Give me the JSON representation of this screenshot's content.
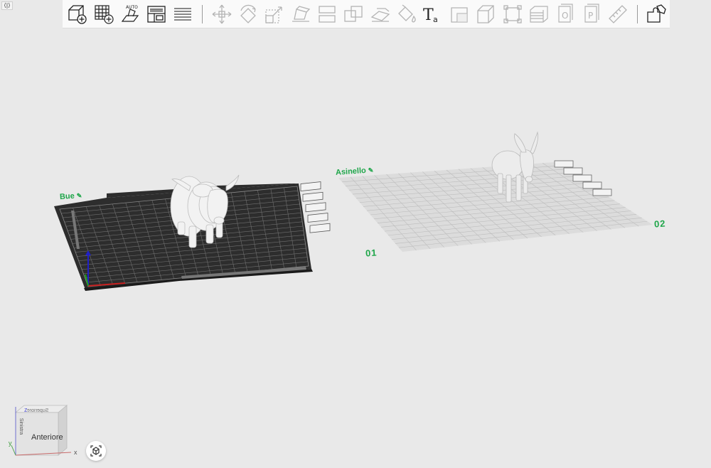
{
  "panel_toggle": "⟨|⟩",
  "toolbar": {
    "buttons": [
      {
        "icon": "add-object-icon",
        "enabled": true
      },
      {
        "icon": "add-plate-icon",
        "enabled": true
      },
      {
        "icon": "auto-arrange-icon",
        "label": "AUTO",
        "enabled": true
      },
      {
        "icon": "layout-icon",
        "enabled": true
      },
      {
        "icon": "slice-layers-icon",
        "enabled": true
      },
      {
        "icon": "move-icon",
        "enabled": false
      },
      {
        "icon": "rotate-icon",
        "enabled": false
      },
      {
        "icon": "scale-icon",
        "enabled": false
      },
      {
        "icon": "lay-on-face-icon",
        "enabled": false
      },
      {
        "icon": "split-icon",
        "enabled": false
      },
      {
        "icon": "boolean-icon",
        "enabled": false
      },
      {
        "icon": "cut-icon",
        "enabled": false
      },
      {
        "icon": "paint-icon",
        "enabled": false
      },
      {
        "icon": "text-icon",
        "label": "Ta",
        "enabled": true
      },
      {
        "icon": "support-icon",
        "enabled": false
      },
      {
        "icon": "box-icon",
        "enabled": false
      },
      {
        "icon": "measure-icon",
        "enabled": false
      },
      {
        "icon": "layers-icon",
        "enabled": false
      },
      {
        "icon": "object-o-icon",
        "label": "O",
        "enabled": false
      },
      {
        "icon": "object-p-icon",
        "label": "P",
        "enabled": false
      },
      {
        "icon": "ruler-icon",
        "enabled": false
      },
      {
        "icon": "assembly-icon",
        "enabled": true
      }
    ]
  },
  "plates": [
    {
      "name": "Bue",
      "number": "01",
      "model": "bull",
      "active": true,
      "color": "#3a3a3a"
    },
    {
      "name": "Asinello",
      "number": "02",
      "model": "donkey",
      "active": false,
      "color": "#d9d9d9"
    }
  ],
  "view_cube": {
    "front": "Anteriore",
    "top": "Superiore",
    "left": "Sinistra",
    "axes": {
      "x": "x",
      "y": "y",
      "z": "z"
    }
  },
  "colors": {
    "accent": "#1fa64a",
    "background": "#e9e9e9"
  }
}
